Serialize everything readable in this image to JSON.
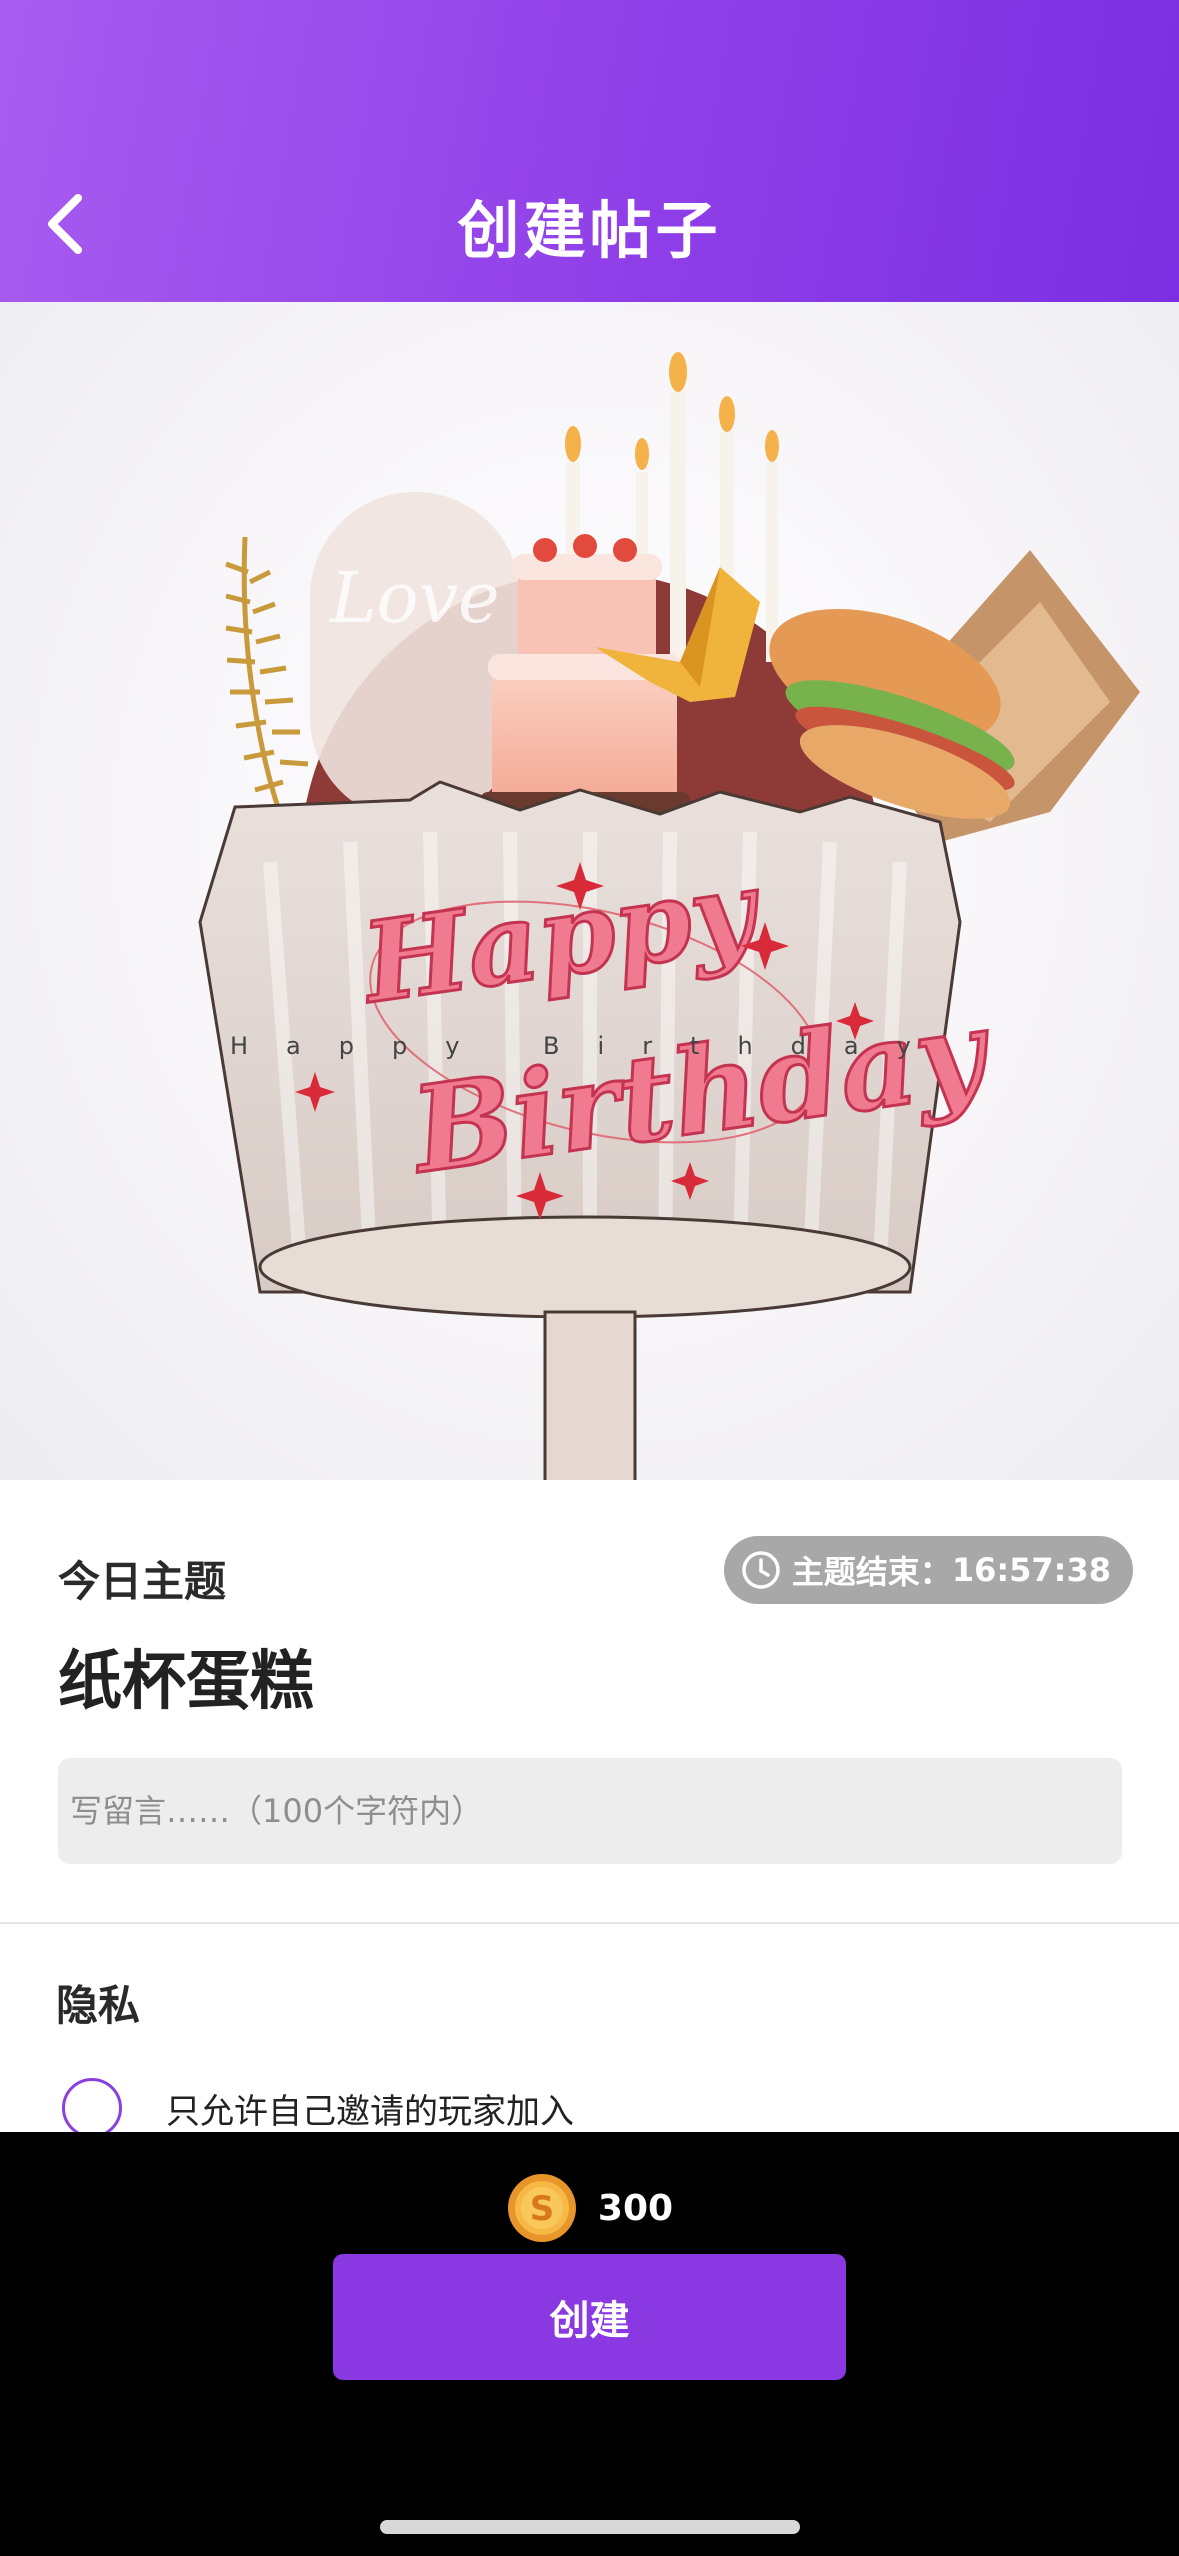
{
  "header": {
    "title": "创建帖子",
    "back_icon": "chevron-left-icon",
    "gradient_colors": [
      "#a85cf0",
      "#7a2fe2"
    ]
  },
  "hero": {
    "main_text_1": "Happy",
    "main_text_2": "Birthday",
    "wide_text": "Happy Birthday",
    "plaque_text": "Love"
  },
  "topic": {
    "label": "今日主题",
    "timer_prefix": "主题结束：",
    "timer_value": "16:57:38",
    "timer_icon": "clock-icon",
    "name": "纸杯蛋糕",
    "message_placeholder": "写留言……（100个字符内）",
    "message_value": ""
  },
  "privacy": {
    "title": "隐私",
    "option_label": "只允许自己邀请的玩家加入",
    "option_selected": false
  },
  "footer": {
    "coin_icon": "gold-coin-icon",
    "price": "300",
    "create_label": "创建",
    "accent_color": "#8a38e2"
  }
}
